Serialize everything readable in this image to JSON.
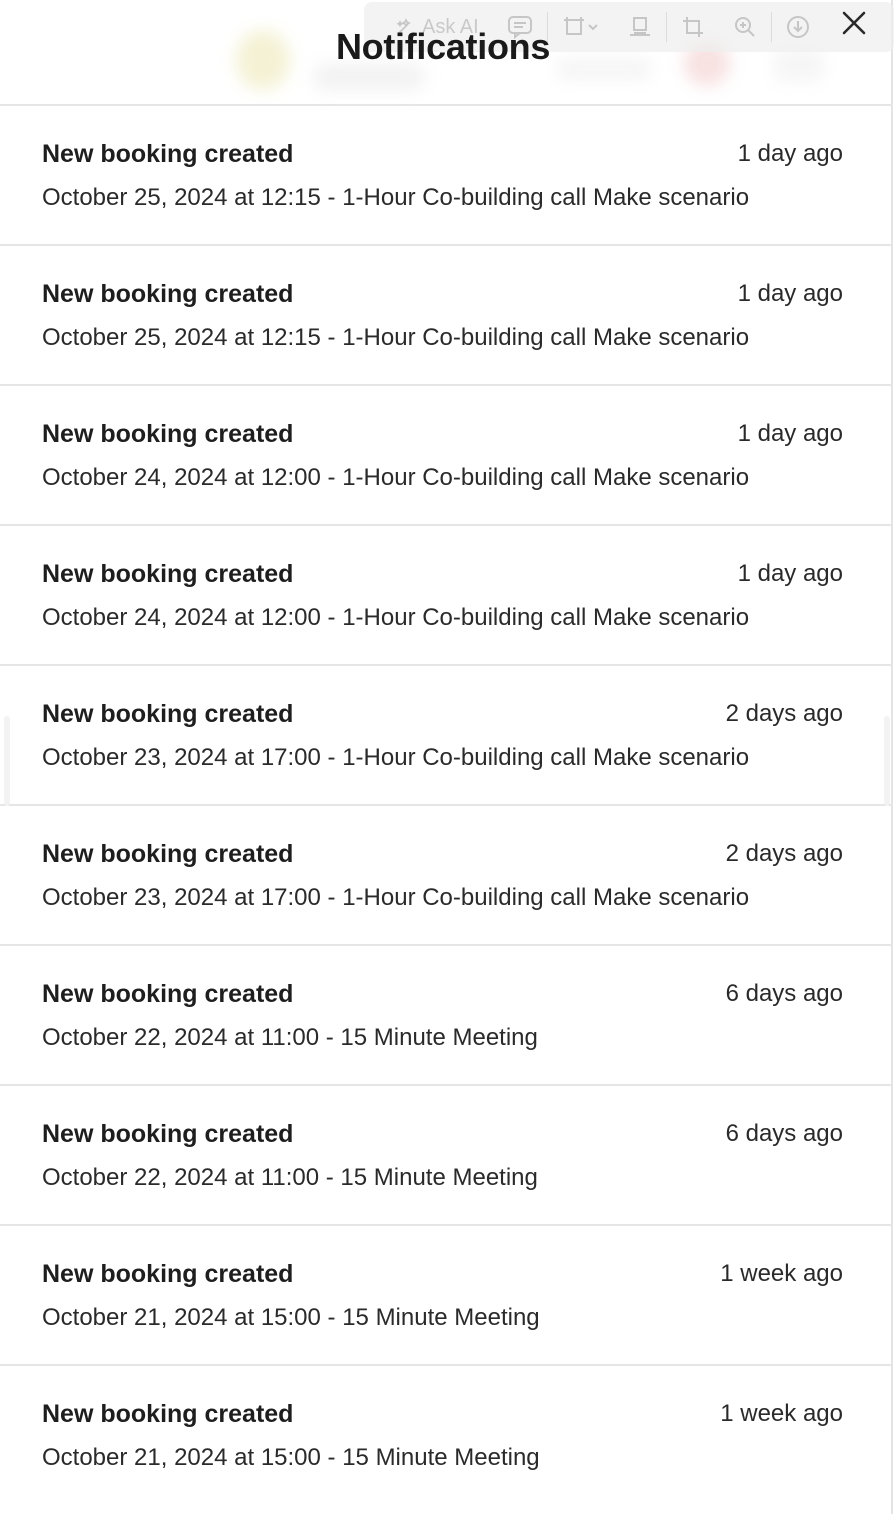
{
  "header": {
    "title": "Notifications",
    "toolbar": {
      "ask_ai_label": "Ask AI"
    }
  },
  "notifications": [
    {
      "title": "New booking created",
      "time": "1 day ago",
      "description": "October 25, 2024 at 12:15 - 1-Hour Co-building call Make scenario"
    },
    {
      "title": "New booking created",
      "time": "1 day ago",
      "description": "October 25, 2024 at 12:15 - 1-Hour Co-building call Make scenario"
    },
    {
      "title": "New booking created",
      "time": "1 day ago",
      "description": "October 24, 2024 at 12:00 - 1-Hour Co-building call Make scenario"
    },
    {
      "title": "New booking created",
      "time": "1 day ago",
      "description": "October 24, 2024 at 12:00 - 1-Hour Co-building call Make scenario"
    },
    {
      "title": "New booking created",
      "time": "2 days ago",
      "description": "October 23, 2024 at 17:00 - 1-Hour Co-building call Make scenario"
    },
    {
      "title": "New booking created",
      "time": "2 days ago",
      "description": "October 23, 2024 at 17:00 - 1-Hour Co-building call Make scenario"
    },
    {
      "title": "New booking created",
      "time": "6 days ago",
      "description": "October 22, 2024 at 11:00 - 15 Minute Meeting"
    },
    {
      "title": "New booking created",
      "time": "6 days ago",
      "description": "October 22, 2024 at 11:00 - 15 Minute Meeting"
    },
    {
      "title": "New booking created",
      "time": "1 week ago",
      "description": "October 21, 2024 at 15:00 - 15 Minute Meeting"
    },
    {
      "title": "New booking created",
      "time": "1 week ago",
      "description": "October 21, 2024 at 15:00 - 15 Minute Meeting"
    }
  ]
}
